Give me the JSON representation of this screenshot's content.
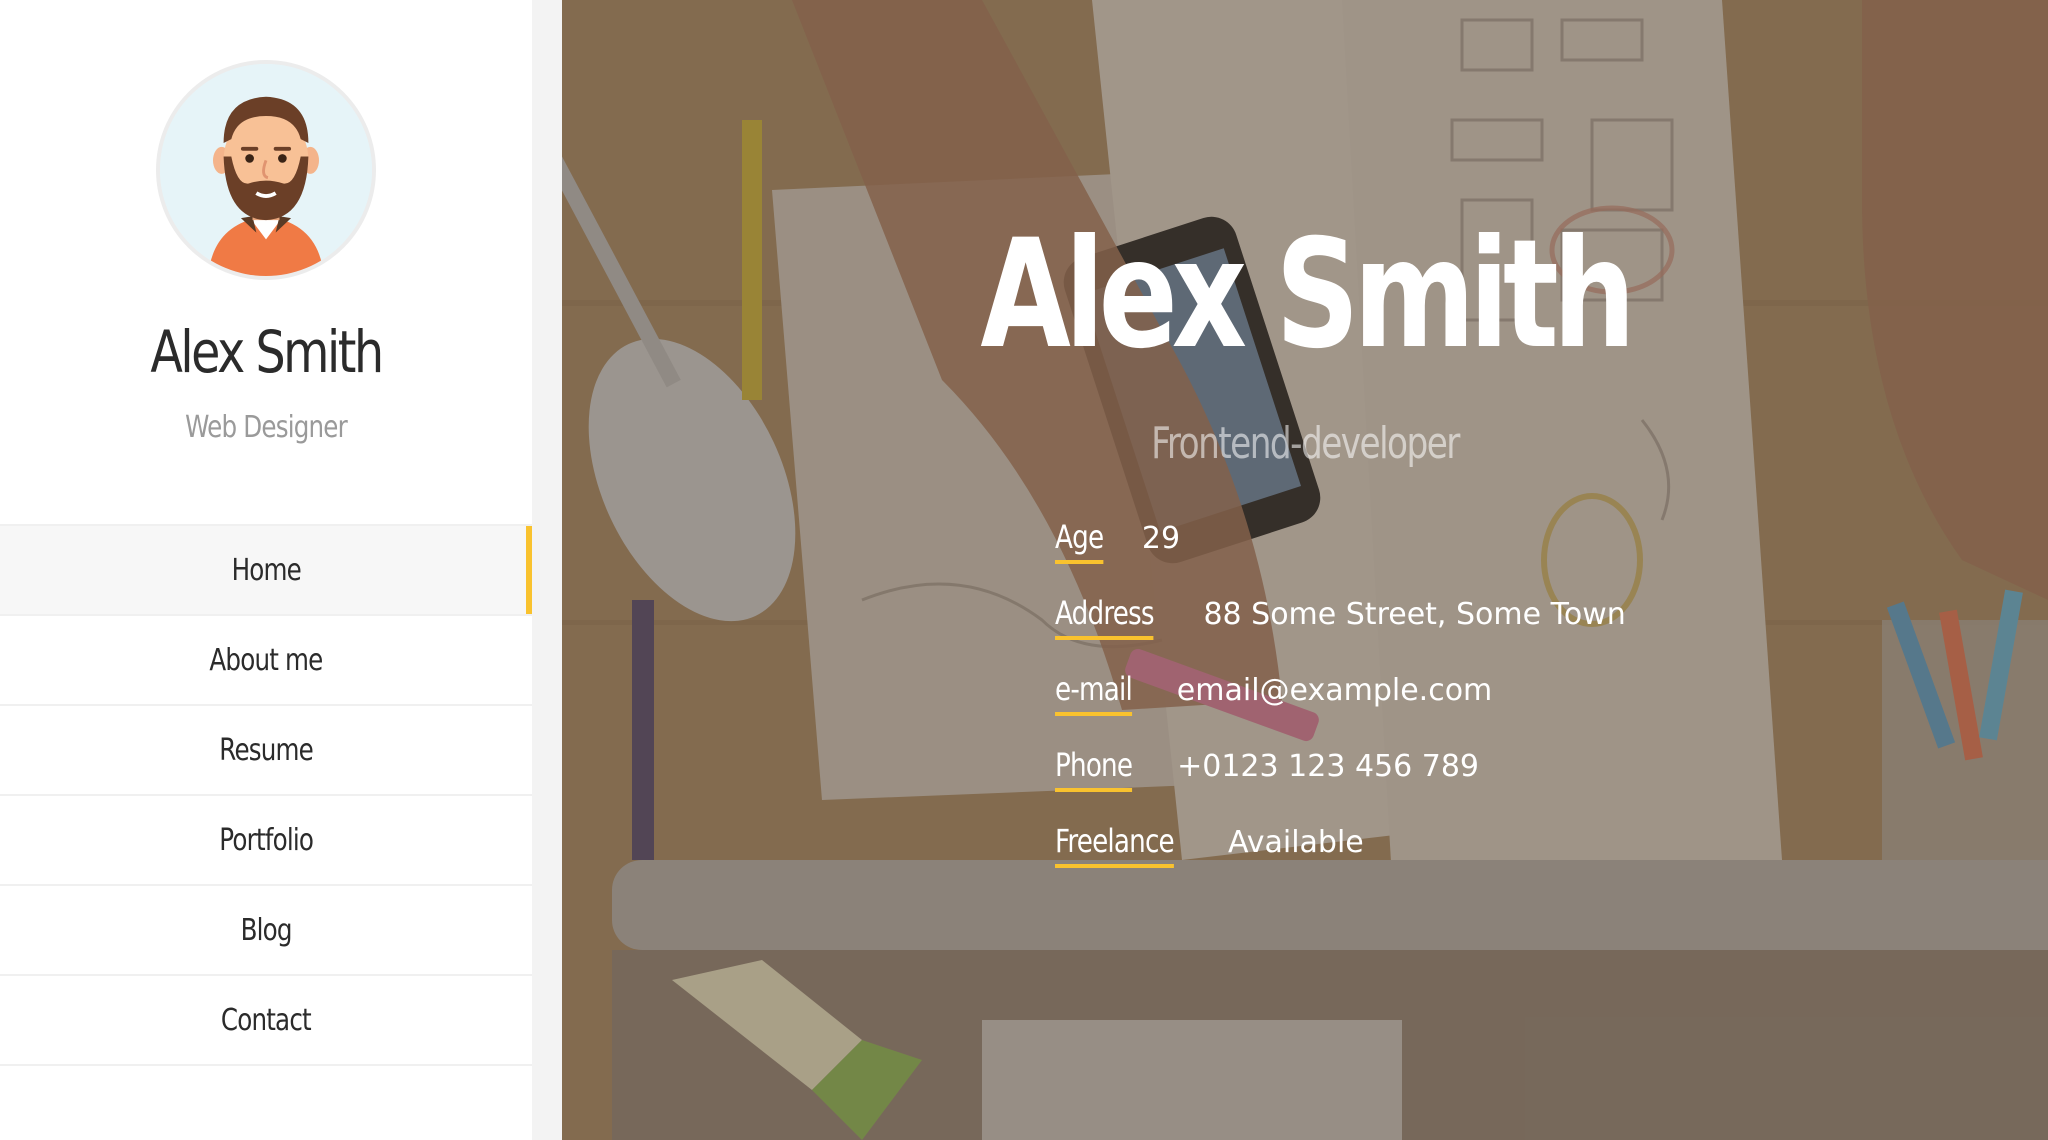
{
  "profile": {
    "name": "Alex Smith",
    "role": "Web Designer"
  },
  "nav": {
    "items": [
      {
        "label": "Home",
        "active": true
      },
      {
        "label": "About me",
        "active": false
      },
      {
        "label": "Resume",
        "active": false
      },
      {
        "label": "Portfolio",
        "active": false
      },
      {
        "label": "Blog",
        "active": false
      },
      {
        "label": "Contact",
        "active": false
      }
    ]
  },
  "hero": {
    "name": "Alex Smith",
    "subtitle": "Frontend-developer",
    "info": [
      {
        "label": "Age",
        "value": "29"
      },
      {
        "label": "Address",
        "value": "88 Some Street, Some Town"
      },
      {
        "label": "e-mail",
        "value": "email@example.com"
      },
      {
        "label": "Phone",
        "value": "+0123 123 456 789"
      },
      {
        "label": "Freelance",
        "value": "Available"
      }
    ]
  },
  "colors": {
    "accent": "#f9c22e",
    "text_dark": "#2b2b2b",
    "text_muted": "#9a9a9a",
    "sidebar_bg": "#ffffff"
  }
}
